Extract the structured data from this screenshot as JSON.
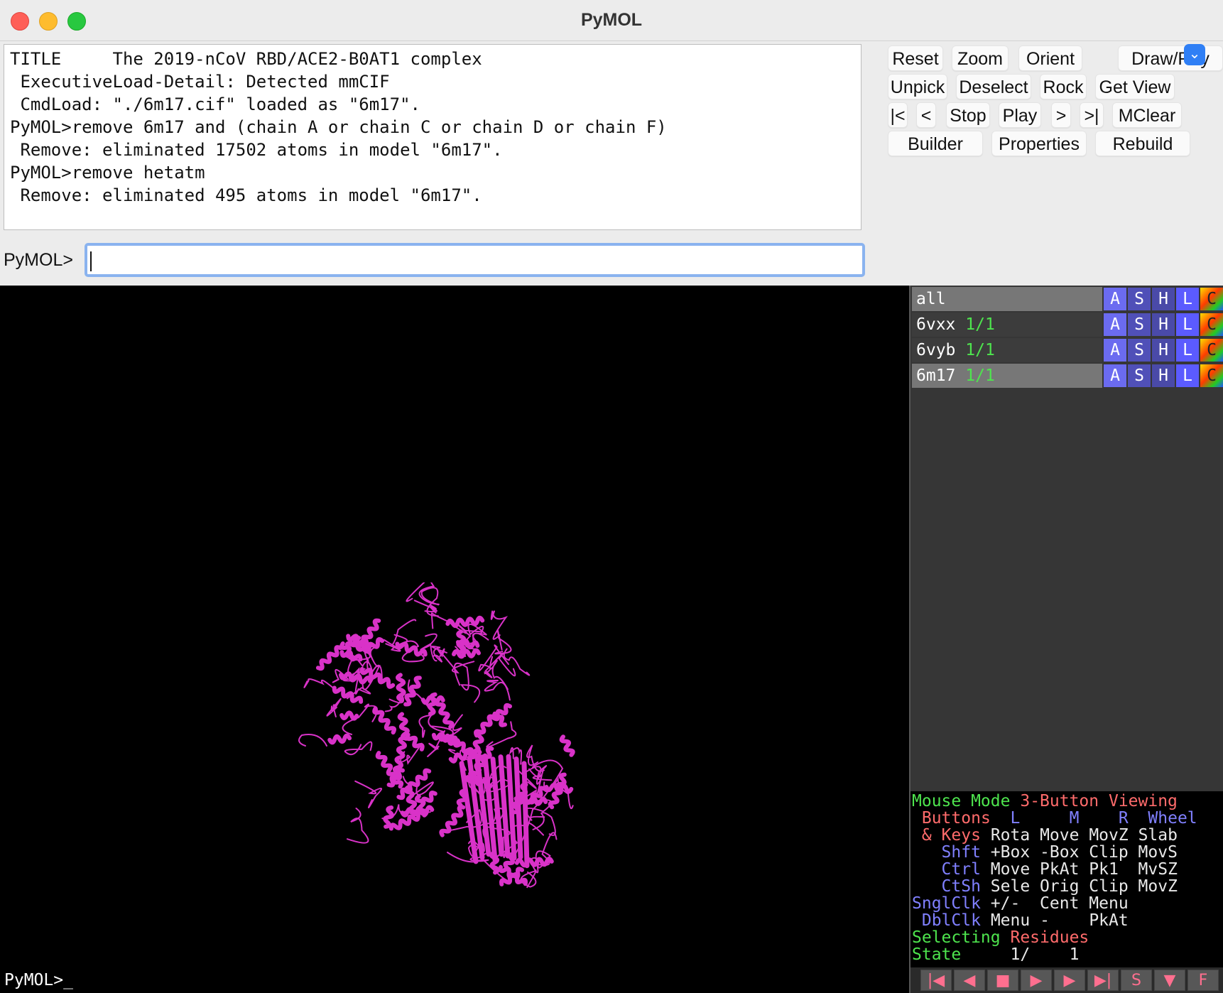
{
  "window": {
    "title": "PyMOL"
  },
  "console_lines": [
    "TITLE     The 2019-nCoV RBD/ACE2-B0AT1 complex",
    " ExecutiveLoad-Detail: Detected mmCIF",
    " CmdLoad: \"./6m17.cif\" loaded as \"6m17\".",
    "PyMOL>remove 6m17 and (chain A or chain C or chain D or chain F)",
    " Remove: eliminated 17502 atoms in model \"6m17\".",
    "PyMOL>remove hetatm",
    " Remove: eliminated 495 atoms in model \"6m17\"."
  ],
  "command": {
    "label": "PyMOL>",
    "value": ""
  },
  "buttons": {
    "row1": [
      "Reset",
      "Zoom",
      "Orient",
      "Draw/Ray"
    ],
    "row2": [
      "Unpick",
      "Deselect",
      "Rock",
      "Get View"
    ],
    "row3": [
      "|<",
      "<",
      "Stop",
      "Play",
      ">",
      ">|",
      "MClear"
    ],
    "row4": [
      "Builder",
      "Properties",
      "Rebuild"
    ]
  },
  "objects": [
    {
      "name": "all",
      "state": ""
    },
    {
      "name": "6vxx",
      "state": "1/1"
    },
    {
      "name": "6vyb",
      "state": "1/1"
    },
    {
      "name": "6m17",
      "state": "1/1"
    }
  ],
  "object_buttons": [
    "A",
    "S",
    "H",
    "L",
    "C"
  ],
  "mouse_mode": {
    "title": "Mouse Mode",
    "mode": "3-Button Viewing",
    "buttons_label": "Buttons",
    "cols": [
      "L",
      "M",
      "R",
      "Wheel"
    ],
    "rows": [
      {
        "key": "& Keys",
        "vals": [
          "Rota",
          "Move",
          "MovZ",
          "Slab"
        ]
      },
      {
        "key": "Shft",
        "vals": [
          "+Box",
          "-Box",
          "Clip",
          "MovS"
        ]
      },
      {
        "key": "Ctrl",
        "vals": [
          "Move",
          "PkAt",
          "Pk1",
          "MvSZ"
        ]
      },
      {
        "key": "CtSh",
        "vals": [
          "Sele",
          "Orig",
          "Clip",
          "MovZ"
        ]
      },
      {
        "key": "SnglClk",
        "vals": [
          "+/-",
          "Cent",
          "Menu",
          ""
        ]
      },
      {
        "key": "DblClk",
        "vals": [
          "Menu",
          "-",
          "PkAt",
          ""
        ]
      }
    ],
    "selecting_label": "Selecting",
    "selecting_value": "Residues",
    "state_label": "State",
    "state_value": "1/    1"
  },
  "bottom_prompt": "PyMOL>_",
  "transport": [
    "|◀",
    "◀",
    "■",
    "▶",
    "▶",
    "▶|",
    "S",
    "▼",
    "F"
  ],
  "colors": {
    "cartoon": "#d932c8",
    "viewer_bg": "#000000",
    "state_green": "#4ee44e",
    "btn_A": "#6b6bf0",
    "btn_S": "#5050b8",
    "btn_H": "#4a4aa8",
    "btn_L": "#5b5bff"
  }
}
